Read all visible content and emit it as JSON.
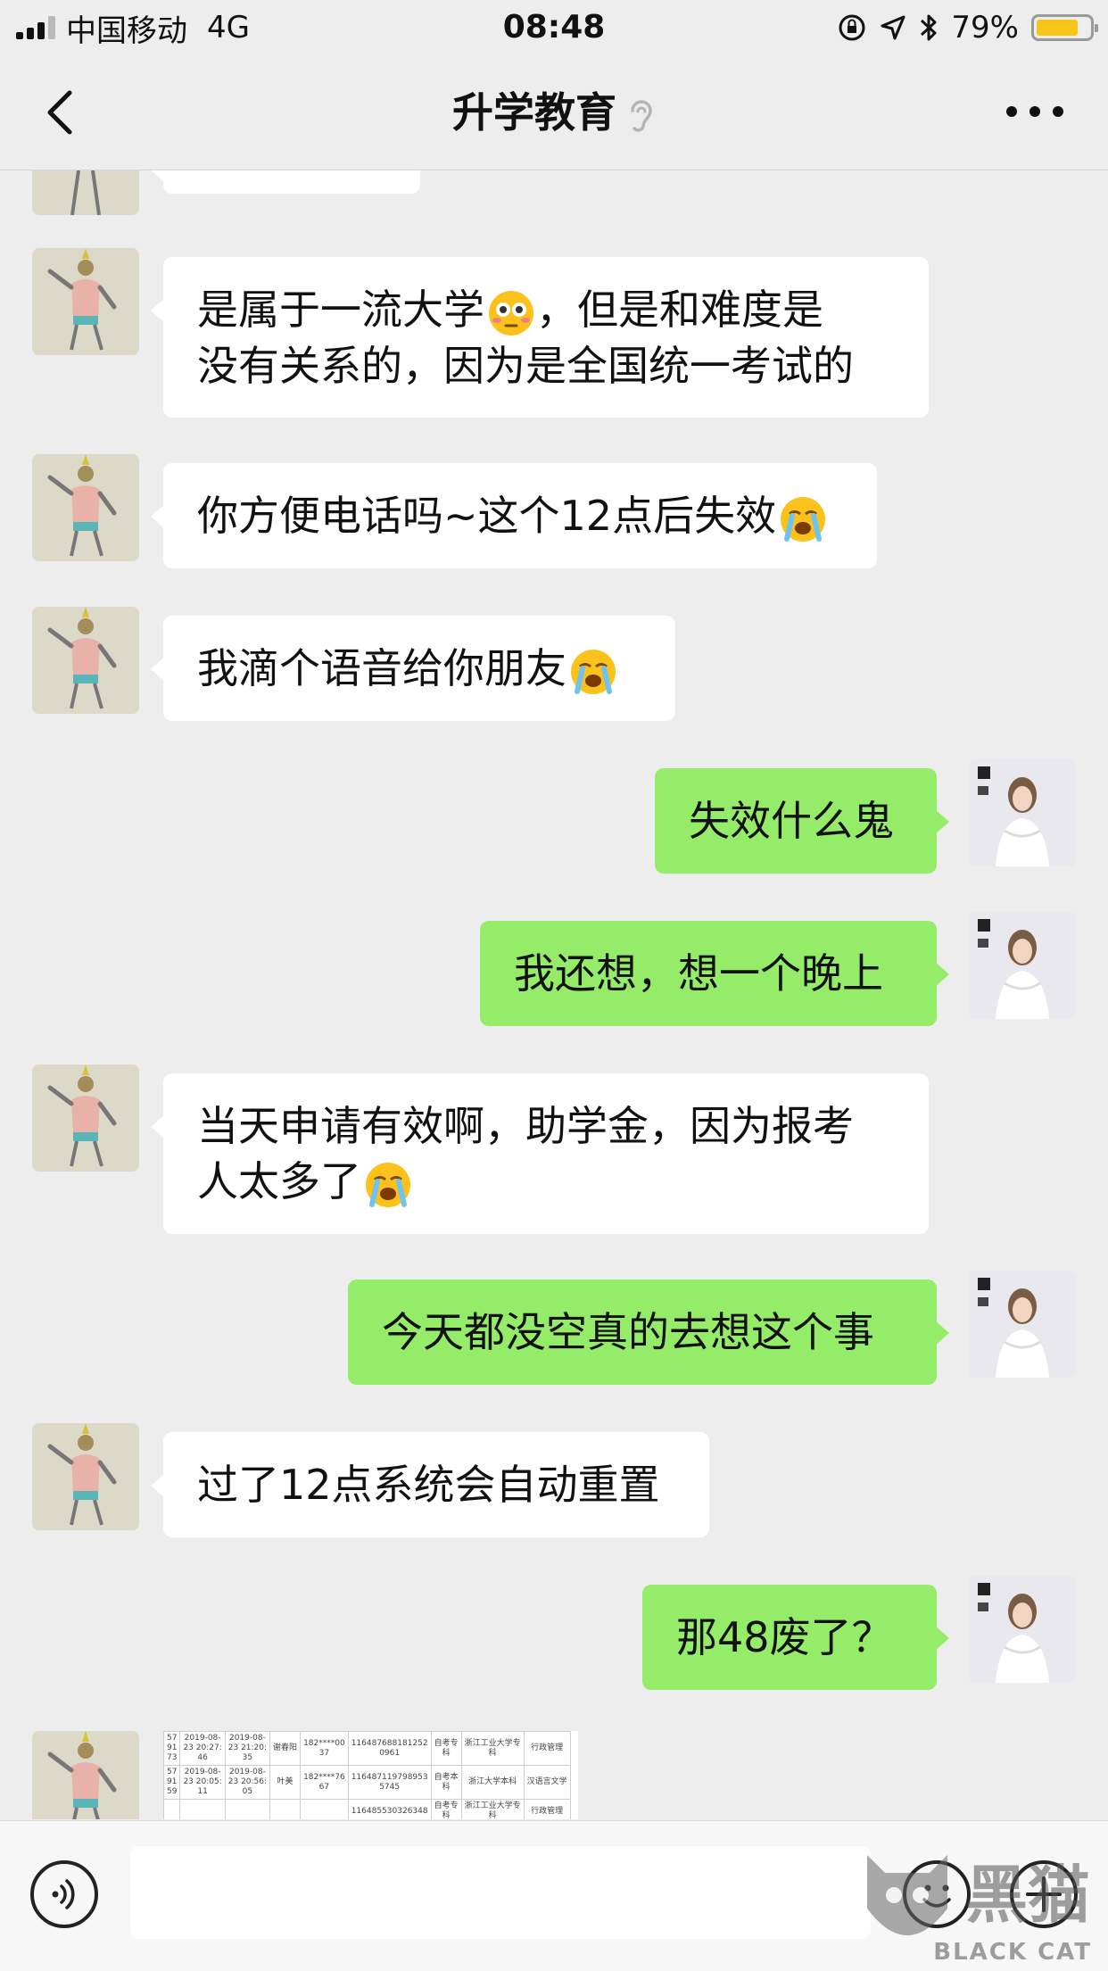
{
  "status_bar": {
    "carrier": "中国移动",
    "network": "4G",
    "time": "08:48",
    "battery": "79%",
    "battery_level": 0.79
  },
  "nav": {
    "title": "升学教育"
  },
  "messages": [
    {
      "side": "them",
      "lines": [
        "是属于一流大学😳，但是和难度是",
        "没有关系的，因为是全国统一考试的"
      ]
    },
    {
      "side": "them",
      "lines": [
        "你方便电话吗~这个12点后失效😭"
      ]
    },
    {
      "side": "them",
      "lines": [
        "我滴个语音给你朋友😭"
      ]
    },
    {
      "side": "me",
      "lines": [
        "失效什么鬼"
      ]
    },
    {
      "side": "me",
      "lines": [
        "我还想，想一个晚上"
      ]
    },
    {
      "side": "them",
      "lines": [
        "当天申请有效啊，助学金，因为报考",
        "人太多了😭"
      ]
    },
    {
      "side": "me",
      "lines": [
        "今天都没空真的去想这个事"
      ]
    },
    {
      "side": "them",
      "lines": [
        "过了12点系统会自动重置"
      ]
    },
    {
      "side": "me",
      "lines": [
        "那48废了？"
      ]
    }
  ],
  "image_message": {
    "rows": [
      [
        "57\n91\n73",
        "2019-08-\n23 20:27:\n46",
        "2019-08-\n23 21:20:\n35",
        "谢春阳",
        "182****00\n37",
        "116487688181252\n0961",
        "自考专\n科",
        "浙江工业大学专\n科",
        "行政管理"
      ],
      [
        "57\n91\n59",
        "2019-08-\n23 20:05:\n11",
        "2019-08-\n23 20:56:\n05",
        "叶美",
        "182****76\n67",
        "116487119798953\n5745",
        "自考本\n科",
        "浙江大学本科",
        "汉语言文学"
      ],
      [
        "",
        "",
        "",
        "",
        "",
        "116485530326348",
        "自考专\n科",
        "浙江工业大学专\n科",
        "行政管理"
      ]
    ]
  },
  "watermark": {
    "brand": "黑猫",
    "brand_en": "BLACK CAT"
  },
  "colors": {
    "background": "#ededed",
    "my_bubble": "#95ec69",
    "their_bubble": "#ffffff",
    "battery_fill": "#f5c518"
  }
}
